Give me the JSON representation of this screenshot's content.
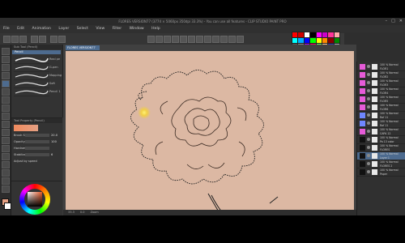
{
  "app": {
    "title": "FLORES VERSION77 (3774 × 5060px 350dpi 33.3%) - You can use all features - CLIP STUDIO PAINT PRO",
    "menus": [
      "File",
      "Edit",
      "Animation",
      "Layer",
      "Select",
      "View",
      "Filter",
      "Window",
      "Help"
    ]
  },
  "subtool": {
    "header": "Sub Tool (Pencil)",
    "selected_tab": "Pencil",
    "strokes": [
      {
        "label": "Real pe"
      },
      {
        "label": "G-pen"
      },
      {
        "label": "Mapping"
      },
      {
        "label": "Soft"
      },
      {
        "label": "Pencil 1"
      }
    ]
  },
  "toolprop": {
    "header": "Tool Property (Pencil)",
    "rows": [
      {
        "label": "Brush Size",
        "value": "20.0"
      },
      {
        "label": "Opacity",
        "value": "100"
      },
      {
        "label": "Hardness",
        "value": ""
      },
      {
        "label": "Stabilization",
        "value": "6"
      },
      {
        "label": "Adjust by speed",
        "value": ""
      }
    ]
  },
  "canvas": {
    "doc_tab": "FLORES VERSION77",
    "status": [
      "33.3",
      "0.0",
      "Zoom"
    ]
  },
  "layers": [
    {
      "label": "100 % Normal",
      "name": "FLOR1",
      "color": "#e65bd8"
    },
    {
      "label": "100 % Normal",
      "name": "FLOR2",
      "color": "#e65bd8"
    },
    {
      "label": "100 % Normal",
      "name": "FLOR3",
      "color": "#e65bd8"
    },
    {
      "label": "100 % Normal",
      "name": "FLOR4",
      "color": "#e65bd8"
    },
    {
      "label": "100 % Normal",
      "name": "FLOR5",
      "color": "#e65bd8"
    },
    {
      "label": "100 % Normal",
      "name": "FLOR6",
      "color": "#e65bd8"
    },
    {
      "label": "100 % Normal",
      "name": "Raf 11",
      "color": "#6f86ff"
    },
    {
      "label": "100 % Normal",
      "name": "Raf 11",
      "color": "#6f86ff"
    },
    {
      "label": "100 % Normal",
      "name": "CAPA 12",
      "color": "#e65bd8"
    },
    {
      "label": "100 % Normal",
      "name": "Pa 13 color",
      "color": "#111111"
    },
    {
      "label": "100 % Normal",
      "name": "FLORES",
      "color": "#111111"
    },
    {
      "label": "100 % Normal",
      "name": "Layer 1",
      "color": "#111111"
    },
    {
      "label": "100 % Normal",
      "name": "FLORES 2",
      "color": "#111111"
    },
    {
      "label": "100 % Normal",
      "name": "Paper",
      "color": "#111111"
    }
  ],
  "colors": {
    "canvas_bg": "#dcb8a3",
    "accent": "#4d6b8f",
    "main_color": "#e5a083"
  }
}
